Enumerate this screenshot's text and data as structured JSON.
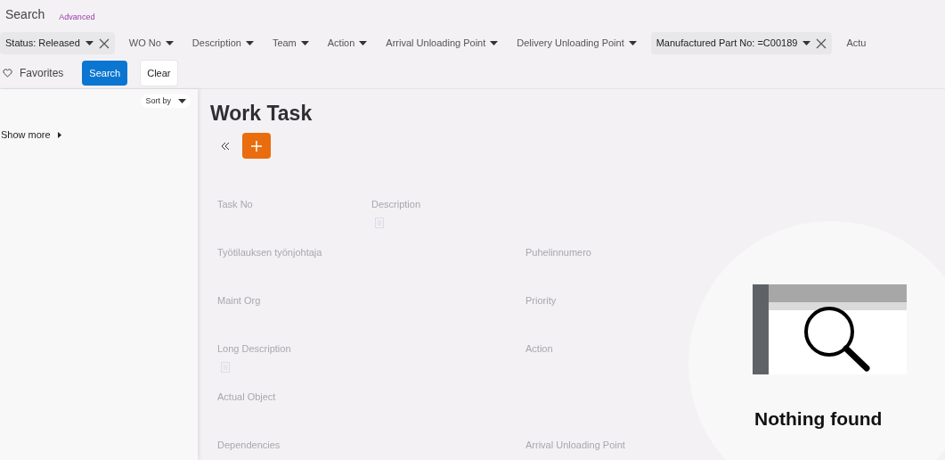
{
  "search": {
    "title": "Search",
    "advanced_link": "Advanced"
  },
  "filters": [
    {
      "label": "Status: Released",
      "active": true
    },
    {
      "label": "WO No",
      "active": false
    },
    {
      "label": "Description",
      "active": false
    },
    {
      "label": "Team",
      "active": false
    },
    {
      "label": "Action",
      "active": false
    },
    {
      "label": "Arrival Unloading Point",
      "active": false
    },
    {
      "label": "Delivery Unloading Point",
      "active": false
    },
    {
      "label": "Manufactured Part No: =C00189",
      "active": true
    },
    {
      "label": "Actu",
      "active": false
    }
  ],
  "favorites": "Favorites",
  "search_button": "Search",
  "clear_button": "Clear",
  "sidebar": {
    "sort_by": "Sort by",
    "show_more": "Show more"
  },
  "page_title": "Work Task",
  "form_rows": [
    {
      "left": {
        "label": "Task No",
        "note": false
      },
      "middle": {
        "label": "Description",
        "note": true
      }
    },
    {
      "left": {
        "label": "Työtilauksen työnjohtaja",
        "note": false
      },
      "right": {
        "label": "Puhelinnumero",
        "note": false
      }
    },
    {
      "left": {
        "label": "Maint Org",
        "note": false
      },
      "right": {
        "label": "Priority",
        "note": false
      }
    },
    {
      "left": {
        "label": "Long Description",
        "note": true
      },
      "right": {
        "label": "Action",
        "note": false
      }
    },
    {
      "left": {
        "label": "Actual Object",
        "note": false
      }
    },
    {
      "left": {
        "label": "Dependencies",
        "note": false
      },
      "right": {
        "label": "Arrival Unloading Point",
        "note": false
      }
    }
  ],
  "empty_state": {
    "message": "Nothing found"
  }
}
